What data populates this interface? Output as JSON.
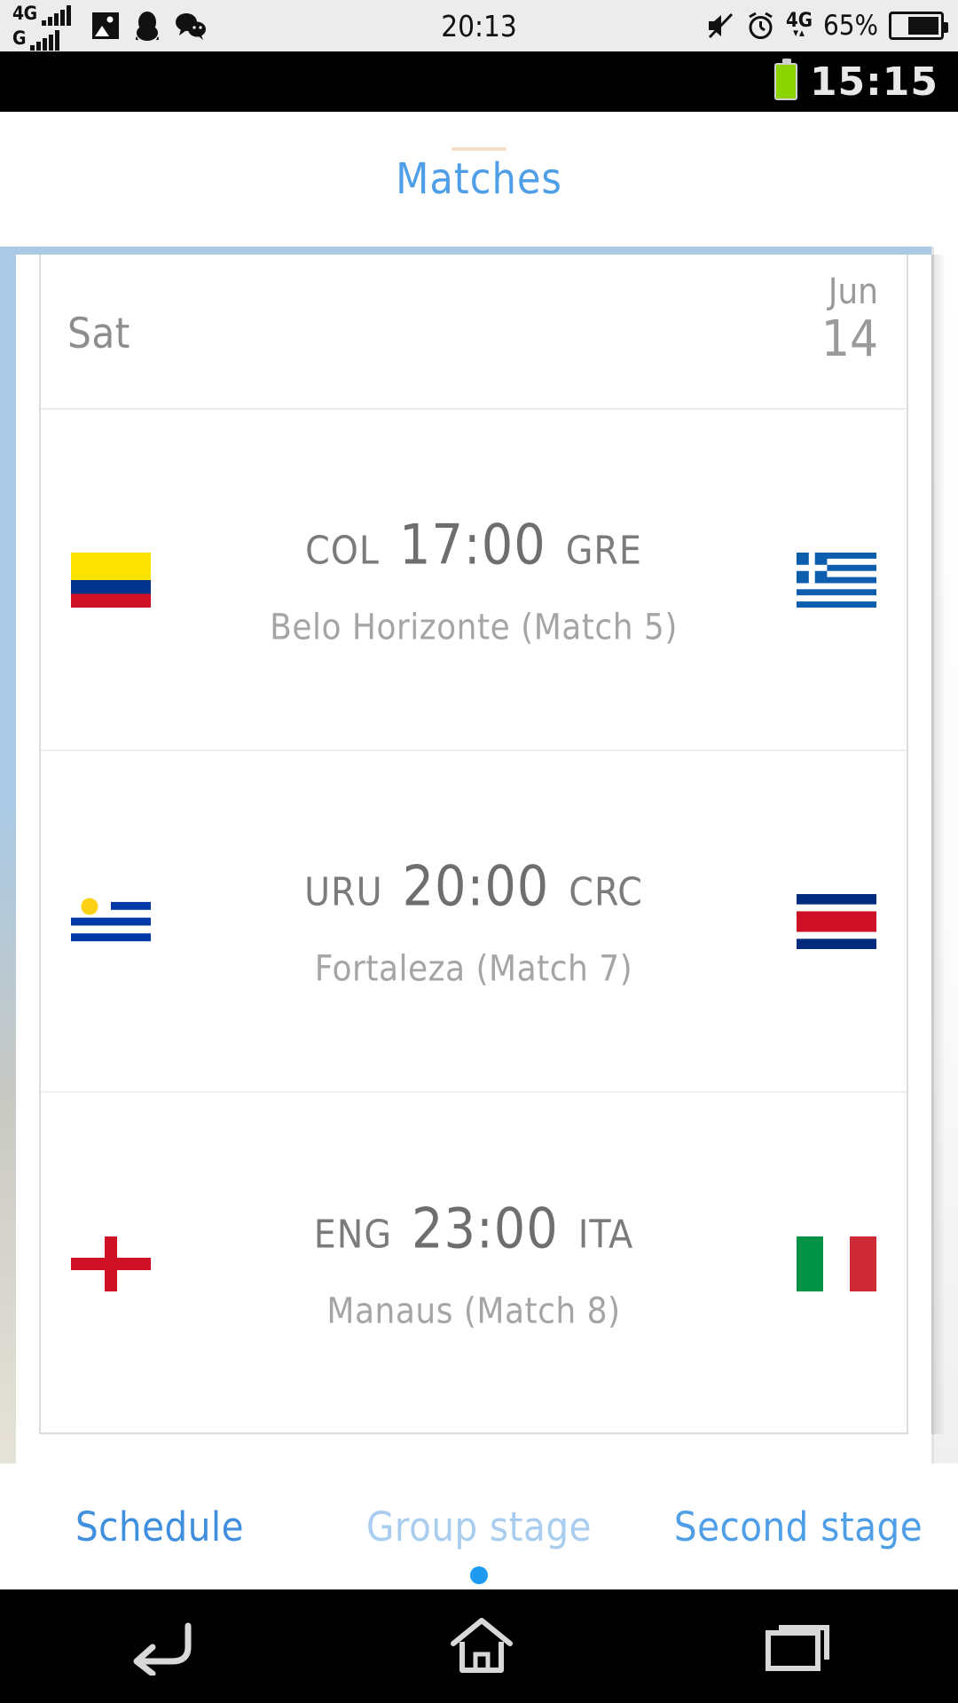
{
  "host_status_bar": {
    "network_primary": "4G",
    "network_secondary": "G",
    "time": "20:13",
    "battery_percent": "65%",
    "data_label": "4G",
    "icons": [
      "gallery-icon",
      "qq-penguin-icon",
      "wechat-icon",
      "mute-icon",
      "alarm-icon",
      "data-arrows-icon",
      "battery-icon"
    ]
  },
  "device_status_bar": {
    "time": "15:15",
    "icons": [
      "battery-icon"
    ]
  },
  "app": {
    "title": "Matches",
    "accent_color": "#4f9ee8",
    "date_header": {
      "weekday": "Sat",
      "month": "Jun",
      "day": "14"
    },
    "matches": [
      {
        "home_code": "COL",
        "away_code": "GRE",
        "kickoff": "17:00",
        "venue": "Belo Horizonte (Match  5)",
        "home_flag": "colombia-flag",
        "away_flag": "greece-flag"
      },
      {
        "home_code": "URU",
        "away_code": "CRC",
        "kickoff": "20:00",
        "venue": "Fortaleza (Match  7)",
        "home_flag": "uruguay-flag",
        "away_flag": "costa-rica-flag"
      },
      {
        "home_code": "ENG",
        "away_code": "ITA",
        "kickoff": "23:00",
        "venue": "Manaus (Match  8)",
        "home_flag": "england-flag",
        "away_flag": "italy-flag"
      }
    ],
    "tabs": [
      {
        "label": "Schedule",
        "state": "active"
      },
      {
        "label": "Group stage",
        "state": "dim"
      },
      {
        "label": "Second stage",
        "state": "normal"
      }
    ]
  },
  "nav_bar": {
    "buttons": [
      "back-icon",
      "home-icon",
      "recents-icon"
    ]
  }
}
